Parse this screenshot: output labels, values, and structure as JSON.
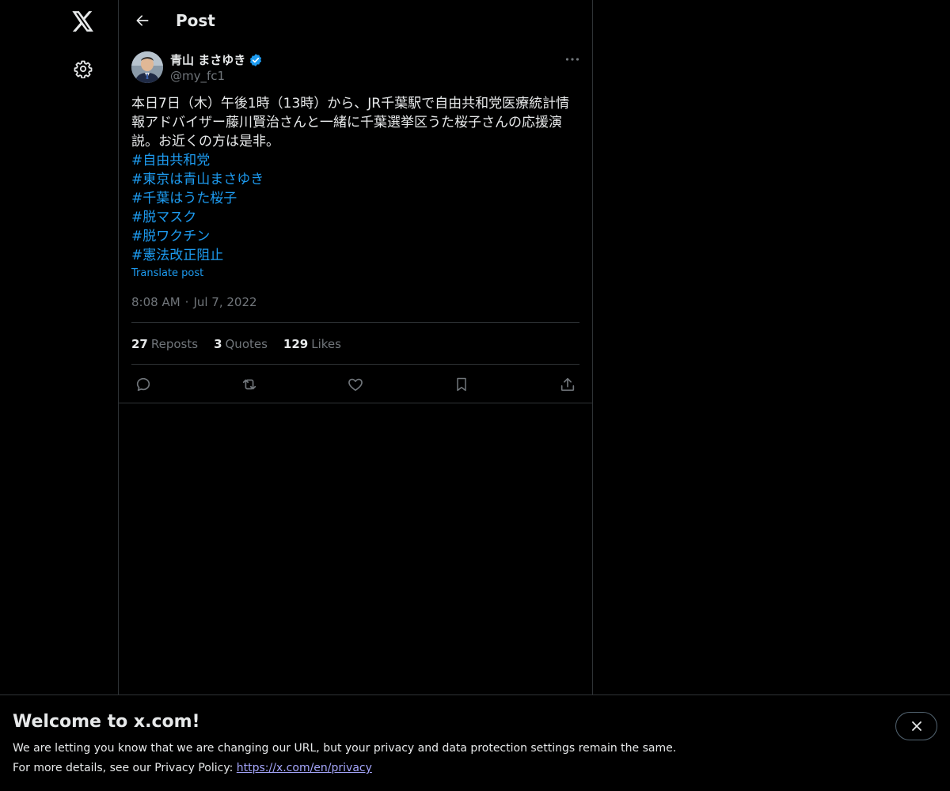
{
  "nav": {
    "logo_icon": "x-logo-icon",
    "settings_icon": "gear-icon"
  },
  "header": {
    "title": "Post",
    "back_icon": "arrow-left-icon"
  },
  "post": {
    "author_name": "青山 まさゆき",
    "author_handle": "@my_fc1",
    "verified": true,
    "text_line1": "本日7日（木）午後1時（13時）から、JR千葉駅で自由共和党医療統計情",
    "text_line2": "報アドバイザー藤川賢治さんと一緒に千葉選挙区うた桜子さんの応援演",
    "text_line3": "説。お近くの方は是非。",
    "hashtags": [
      "#自由共和党",
      "#東京は青山まさゆき",
      "#千葉はうた桜子",
      "#脱マスク",
      "#脱ワクチン",
      "#憲法改正阻止"
    ],
    "translate_label": "Translate post",
    "time": "8:08 AM",
    "separator": "·",
    "date": "Jul 7, 2022",
    "stats": {
      "reposts_count": "27",
      "reposts_label": "Reposts",
      "quotes_count": "3",
      "quotes_label": "Quotes",
      "likes_count": "129",
      "likes_label": "Likes"
    }
  },
  "banner": {
    "title": "Welcome to x.com!",
    "line1": "We are letting you know that we are changing our URL, but your privacy and data protection settings remain the same.",
    "line2_prefix": "For more details, see our Privacy Policy:",
    "link": "https://x.com/en/privacy"
  },
  "colors": {
    "background": "#000000",
    "text": "#e7e9ea",
    "secondary": "#71767b",
    "accent": "#1d9bf0",
    "border": "#2f3336"
  }
}
